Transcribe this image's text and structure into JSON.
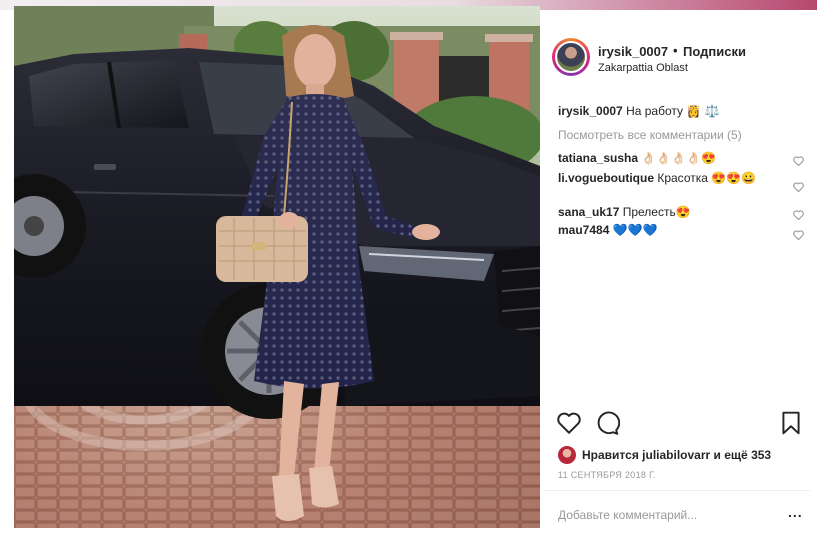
{
  "post": {
    "username": "irysik_0007",
    "dot": "•",
    "follow_label": "Подписки",
    "location": "Zakarpattia Oblast",
    "caption_user": "irysik_0007",
    "caption_text": "На работу 👸 ⚖️",
    "view_all": "Посмотреть все комментарии (5)",
    "comments": [
      {
        "user": "tatiana_susha",
        "text": "👌🏻👌🏻👌🏻👌🏻😍"
      },
      {
        "user": "li.vogueboutique",
        "text": "Красотка 😍😍😀"
      },
      {
        "user": "sana_uk17",
        "text": "Прелесть😍"
      },
      {
        "user": "mau7484",
        "text": "💙💙💙"
      }
    ],
    "likes_prefix": "Нравится",
    "likes_user": "juliabilovarr",
    "likes_suffix": "и ещё 353",
    "date": "11 СЕНТЯБРЯ 2018 Г.",
    "add_comment_placeholder": "Добавьте комментарий...",
    "more": "..."
  },
  "icons": {
    "like": "heart-outline-icon",
    "comment": "speech-bubble-icon",
    "save": "bookmark-icon",
    "comment_like": "small-heart-icon"
  },
  "colors": {
    "text": "#262626",
    "muted": "#999999",
    "divider": "#efefef",
    "accent_strip": "#b7476e"
  }
}
